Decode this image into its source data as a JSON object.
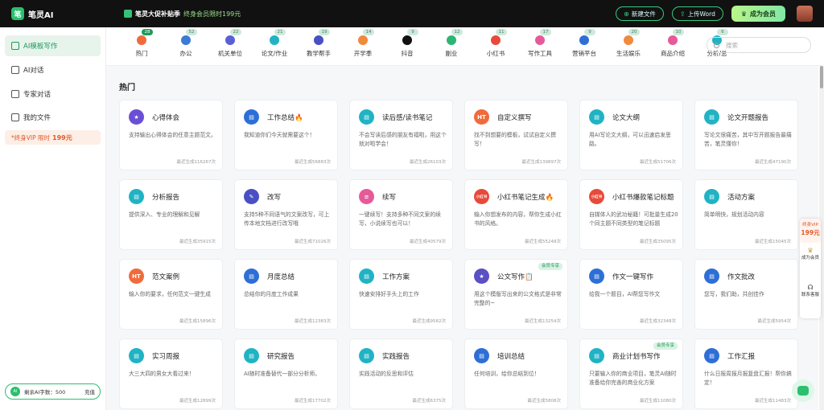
{
  "app": {
    "name": "笔灵AI",
    "logo_char": "笔"
  },
  "promo": {
    "title": "笔灵大促补贴季",
    "price_text": "终身会员限时199元"
  },
  "header_buttons": {
    "new_file": "新建文件",
    "upload_word": "上传Word",
    "become_vip": "成为会员"
  },
  "sidebar": {
    "items": [
      {
        "label": "AI模板写作",
        "active": true
      },
      {
        "label": "AI对话",
        "active": false
      },
      {
        "label": "专家对话",
        "active": false
      },
      {
        "label": "我的文件",
        "active": false
      }
    ],
    "vip_promo": {
      "text": "*终身VIP 限时",
      "price": "199元"
    },
    "word_count": {
      "badge": "AI",
      "label": "剩余AI字数：500",
      "recharge": "充值"
    }
  },
  "tabs": [
    {
      "label": "热门",
      "count": "28",
      "color": "#f06b3c"
    },
    {
      "label": "办公",
      "count": "52",
      "color": "#3a7bd5"
    },
    {
      "label": "机关单位",
      "count": "22",
      "color": "#5a5fd6"
    },
    {
      "label": "论文/作业",
      "count": "21",
      "color": "#20b3c4"
    },
    {
      "label": "教学帮手",
      "count": "19",
      "color": "#4a4fc4"
    },
    {
      "label": "开学季",
      "count": "14",
      "color": "#f08a3c"
    },
    {
      "label": "抖音",
      "count": "9",
      "color": "#111111"
    },
    {
      "label": "副业",
      "count": "12",
      "color": "#2bb673"
    },
    {
      "label": "小红书",
      "count": "11",
      "color": "#e84a3a"
    },
    {
      "label": "写作工具",
      "count": "17",
      "color": "#e65a9a"
    },
    {
      "label": "营销平台",
      "count": "9",
      "color": "#2d6fd6"
    },
    {
      "label": "生活娱乐",
      "count": "20",
      "color": "#f08a3c"
    },
    {
      "label": "商品介绍",
      "count": "10",
      "color": "#e65a9a"
    },
    {
      "label": "分析/总",
      "count": "6",
      "color": "#20b3c4"
    }
  ],
  "search": {
    "placeholder": "搜索"
  },
  "section": {
    "title": "热门"
  },
  "cards": [
    {
      "title": "心得体会",
      "desc": "支持输出心得体会的任意主题范文。",
      "count": "最近生成116267次",
      "icon": "#6a4fd6",
      "glyph": "★"
    },
    {
      "title": "工作总结🔥",
      "desc": "我知道你们今天就需要这个！",
      "count": "最近生成56883次",
      "icon": "#2d6fd6",
      "glyph": "▤"
    },
    {
      "title": "读后感/读书笔记",
      "desc": "不会写读后感的朋友有福啦，用这个就对啦学会！",
      "count": "最近生成26103次",
      "icon": "#20b3c4",
      "glyph": "▤"
    },
    {
      "title": "自定义撰写",
      "desc": "找不到想要的模板，试试自定义撰写！",
      "count": "最近生成139897次",
      "icon": "#f06b3c",
      "glyph": "HT"
    },
    {
      "title": "论文大纲",
      "desc": "用AI写论文大纲，可以迅速启发思路。",
      "count": "最近生成51706次",
      "icon": "#20b3c4",
      "glyph": "▤"
    },
    {
      "title": "论文开题报告",
      "desc": "写论文很痛苦，其中写开题报告最痛苦，笔灵懂你！",
      "count": "最近生成47190次",
      "icon": "#20b3c4",
      "glyph": "▤"
    },
    {
      "title": "分析报告",
      "desc": "提供深入、专业的理解和见解",
      "count": "最近生成35915次",
      "icon": "#20b3c4",
      "glyph": "▤"
    },
    {
      "title": "改写",
      "desc": "支持5种不同语气的文案改写，可上传本地文档进行改写哦",
      "count": "最近生成71026次",
      "icon": "#4a4fc4",
      "glyph": "✎"
    },
    {
      "title": "续写",
      "desc": "一键续写！支持多种不同文案的续写，小说续写也可以！",
      "count": "最近生成40579次",
      "icon": "#e65a9a",
      "glyph": "≡"
    },
    {
      "title": "小红书笔记生成🔥",
      "desc": "输入你想发布的内容，帮你生成小红书的风格。",
      "count": "最近生成55248次",
      "icon": "#e84a3a",
      "glyph": "小红书"
    },
    {
      "title": "小红书爆款笔记标题",
      "desc": "自媒体人的武功秘籍！可批量生成20个同主题不同类型的笔记标题",
      "count": "最近生成35095次",
      "icon": "#e84a3a",
      "glyph": "小红书"
    },
    {
      "title": "活动方案",
      "desc": "简单明快，规划活动内容",
      "count": "最近生成15045次",
      "icon": "#20b3c4",
      "glyph": "▤"
    },
    {
      "title": "范文案例",
      "desc": "输入你的要求，任何范文一键生成",
      "count": "最近生成15896次",
      "icon": "#f06b3c",
      "glyph": "HT"
    },
    {
      "title": "月度总结",
      "desc": "总结你的月度工作成果",
      "count": "最近生成12383次",
      "icon": "#2d6fd6",
      "glyph": "▤"
    },
    {
      "title": "工作方案",
      "desc": "快速安排好手头上的工作",
      "count": "最近生成9582次",
      "icon": "#20b3c4",
      "glyph": "▤"
    },
    {
      "title": "公文写作📋",
      "desc": "用这个模版写出来的公文格式是非常完整的~",
      "count": "最近生成13254次",
      "icon": "#5a4fc4",
      "glyph": "★",
      "tag": "会员专享"
    },
    {
      "title": "作文一键写作",
      "desc": "给我一个题目，AI帮您写作文",
      "count": "最近生成32348次",
      "icon": "#2d6fd6",
      "glyph": "▤"
    },
    {
      "title": "作文批改",
      "desc": "您写，我们助，共创佳作",
      "count": "最近生成5954次",
      "icon": "#2d6fd6",
      "glyph": "▤"
    },
    {
      "title": "实习周报",
      "desc": "大三大四的男女大看过来！",
      "count": "最近生成12899次",
      "icon": "#20b3c4",
      "glyph": "▤"
    },
    {
      "title": "研究报告",
      "desc": "AI随时准备替代一部分分析师。",
      "count": "最近生成17702次",
      "icon": "#20b3c4",
      "glyph": "▤"
    },
    {
      "title": "实践报告",
      "desc": "实践活动的反思和评估",
      "count": "最近生成6375次",
      "icon": "#20b3c4",
      "glyph": "▤"
    },
    {
      "title": "培训总结",
      "desc": "任何培训，给你总结到位！",
      "count": "最近生成5808次",
      "icon": "#2d6fd6",
      "glyph": "▤"
    },
    {
      "title": "商业计划书写作",
      "desc": "只要输入你的商业项目，笔灵AI随时准备给你完善的商业化方案",
      "count": "最近生成11080次",
      "icon": "#20b3c4",
      "glyph": "▤",
      "tag": "会员专享"
    },
    {
      "title": "工作汇报",
      "desc": "什么日报周报月报复盘汇报！帮你搞定！",
      "count": "最近生成11483次",
      "icon": "#2d6fd6",
      "glyph": "▤"
    }
  ],
  "float_panel": {
    "vip_label": "终身VIP",
    "vip_price": "199元",
    "become_member": "成为会员",
    "contact": "联系客服"
  }
}
